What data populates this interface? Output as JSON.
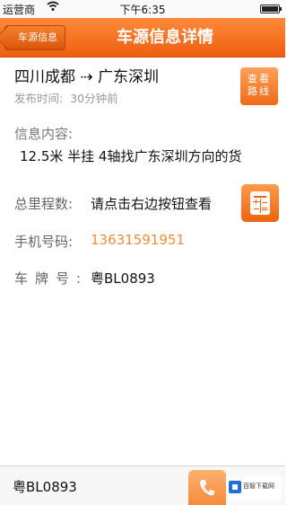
{
  "status_bar": {
    "carrier": "运营商",
    "time": "下午6:35"
  },
  "nav": {
    "back_label": "车源信息",
    "title": "车源信息详情"
  },
  "route": {
    "text": "四川成都 ⇢ 广东深圳",
    "view_button_label": "查看路线"
  },
  "publish": {
    "label": "发布时间:",
    "value": "30分钟前"
  },
  "info": {
    "label": "信息内容:",
    "content": "12.5米 半挂 4轴找广东深圳方向的货"
  },
  "mileage": {
    "label": "总里程数:",
    "value": "请点击右边按钮查看"
  },
  "phone": {
    "label": "手机号码:",
    "value": "13631591951"
  },
  "plate": {
    "label": "车牌号:",
    "value": "粤BL0893"
  },
  "bottom": {
    "plate": "粤BL0893"
  },
  "watermark": {
    "text": "百智下载网"
  }
}
